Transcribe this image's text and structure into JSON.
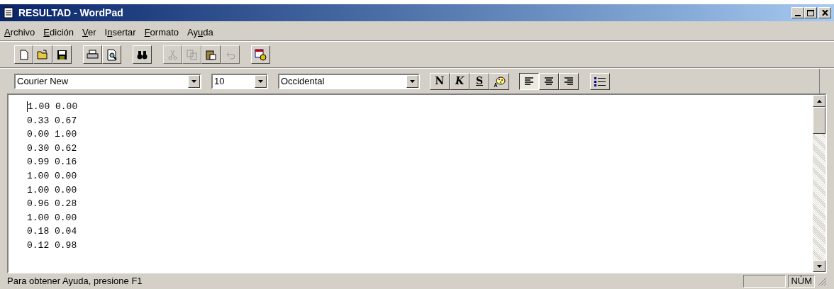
{
  "window": {
    "title": "RESULTAD - WordPad"
  },
  "menu": [
    {
      "key": "A",
      "after": "rchivo"
    },
    {
      "key": "E",
      "after": "dición"
    },
    {
      "key": "V",
      "after": "er"
    },
    {
      "before": "I",
      "key": "n",
      "after": "sertar"
    },
    {
      "key": "F",
      "after": "ormato"
    },
    {
      "before": "Ay",
      "key": "u",
      "after": "da"
    }
  ],
  "toolbar": [
    {
      "kind": "new",
      "disabled": false
    },
    {
      "kind": "open",
      "disabled": false
    },
    {
      "kind": "save",
      "disabled": false
    },
    {
      "kind": "sep"
    },
    {
      "kind": "print",
      "disabled": false
    },
    {
      "kind": "preview",
      "disabled": false
    },
    {
      "kind": "sep"
    },
    {
      "kind": "find",
      "disabled": false
    },
    {
      "kind": "sep"
    },
    {
      "kind": "cut",
      "disabled": true
    },
    {
      "kind": "copy",
      "disabled": true
    },
    {
      "kind": "paste",
      "disabled": false
    },
    {
      "kind": "undo",
      "disabled": true
    },
    {
      "kind": "sep"
    },
    {
      "kind": "datetime",
      "disabled": false
    }
  ],
  "format_bar": {
    "font": "Courier New",
    "size": "10",
    "script": "Occidental",
    "style_buttons": [
      {
        "label": "N",
        "kind": "bold"
      },
      {
        "label": "K",
        "kind": "italic"
      },
      {
        "label": "S",
        "kind": "underline"
      },
      {
        "kind": "color"
      }
    ],
    "align_buttons": [
      {
        "kind": "left",
        "selected": true
      },
      {
        "kind": "center",
        "selected": false
      },
      {
        "kind": "right",
        "selected": false
      }
    ],
    "bullets": {
      "selected": false
    }
  },
  "document": {
    "lines": [
      "1.00 0.00",
      "0.33 0.67",
      "0.00 1.00",
      "0.30 0.62",
      "0.99 0.16",
      "1.00 0.00",
      "1.00 0.00",
      "0.96 0.28",
      "1.00 0.00",
      "0.18 0.04",
      "0.12 0.98"
    ]
  },
  "status_bar": {
    "message": "Para obtener Ayuda, presione F1",
    "panels": [
      {
        "kind": "blank"
      },
      {
        "kind": "text",
        "text": "NÚM"
      }
    ]
  }
}
